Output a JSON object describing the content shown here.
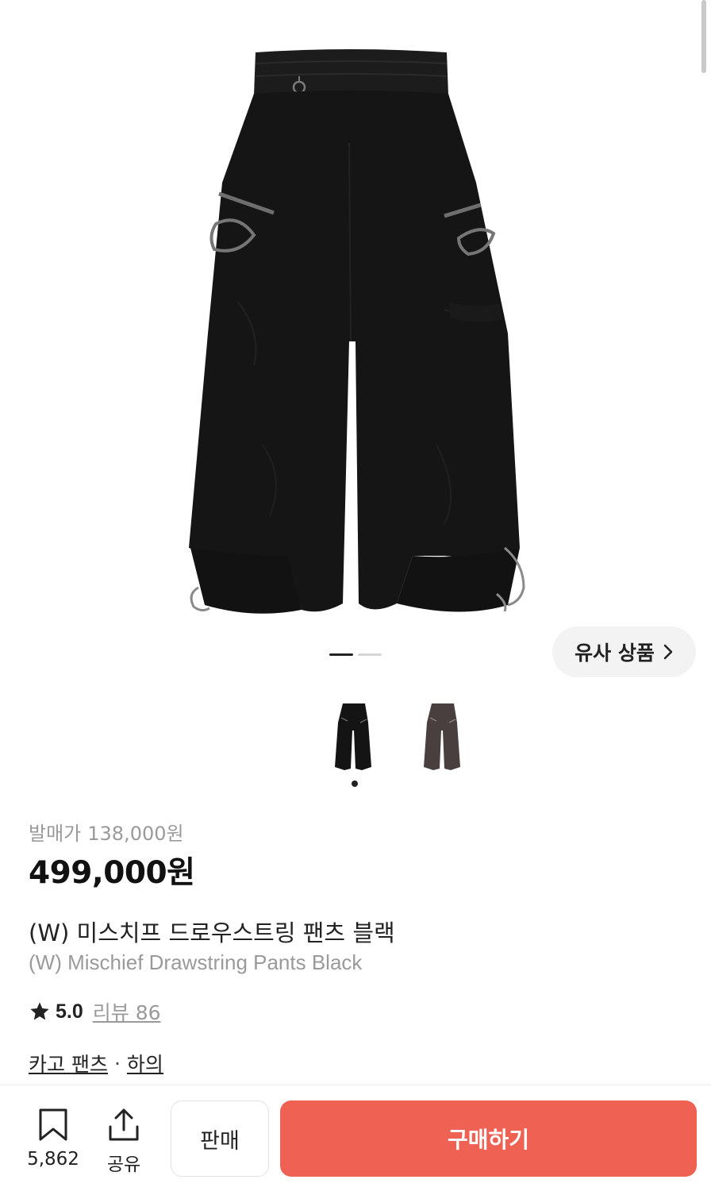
{
  "product": {
    "image_alt_icon": "black-cargo-pants-image",
    "release_label": "발매가",
    "release_price": "138,000원",
    "price": "499,000원",
    "name_ko": "(W) 미스치프 드로우스트링 팬츠 블랙",
    "name_en": "(W) Mischief Drawstring Pants Black",
    "rating": "5.0",
    "review_label": "리뷰 86",
    "category": "카고 팬츠",
    "category_sep": "·",
    "parent_category": "하의"
  },
  "similar_button": {
    "label": "유사 상품",
    "icon": "chevron-right-icon"
  },
  "pager": {
    "current": 1,
    "total": 2
  },
  "thumbnails": [
    {
      "color_name": "black",
      "hex": "#141414",
      "selected": true
    },
    {
      "color_name": "brown",
      "hex": "#4a3f3f",
      "selected": false
    }
  ],
  "bottom_bar": {
    "save_count": "5,862",
    "save_icon": "bookmark-icon",
    "share_label": "공유",
    "share_icon": "share-icon",
    "sell_label": "판매",
    "buy_label": "구매하기"
  },
  "colors": {
    "accent": "#ef6253",
    "muted_text": "#9a9a9a",
    "text": "#222222"
  }
}
